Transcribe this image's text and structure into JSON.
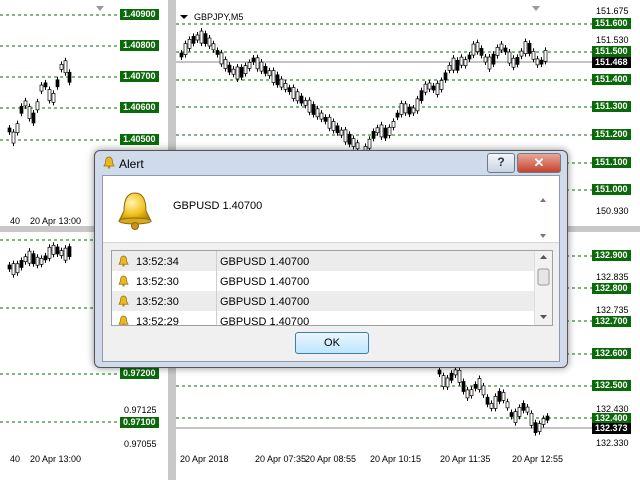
{
  "charts": {
    "tl": {
      "levels": [
        "1.40900",
        "1.40800",
        "1.40700",
        "1.40600",
        "1.40500"
      ],
      "x_labels": [
        "40",
        "20 Apr 13:00"
      ]
    },
    "bl": {
      "levels": [
        "0.97200",
        "0.97100"
      ],
      "prices": [
        "0.97125",
        "0.97055"
      ],
      "x_labels": [
        "40",
        "20 Apr 13:00"
      ]
    },
    "tr": {
      "title": "GBPJPY,M5",
      "levels": [
        "151.600",
        "151.500",
        "151.400",
        "151.300",
        "151.200",
        "151.100",
        "151.000"
      ],
      "current": "151.468",
      "prices": [
        "151.530",
        "150.930"
      ]
    },
    "br": {
      "levels": [
        "132.900",
        "132.800",
        "132.700",
        "132.600",
        "132.500",
        "132.400"
      ],
      "current": "132.373",
      "prices": [
        "132.835",
        "132.735",
        "132.430",
        "132.330"
      ],
      "x_labels": [
        "20 Apr 2018",
        "20 Apr 07:35",
        "20 Apr 08:55",
        "20 Apr 10:15",
        "20 Apr 11:35",
        "20 Apr 12:55"
      ]
    }
  },
  "alert": {
    "title": "Alert",
    "help_label": "?",
    "close_label": "✕",
    "message": "GBPUSD 1.40700",
    "rows": [
      {
        "time": "13:52:34",
        "text": "GBPUSD 1.40700"
      },
      {
        "time": "13:52:30",
        "text": "GBPUSD 1.40700"
      },
      {
        "time": "13:52:30",
        "text": "GBPUSD 1.40700"
      },
      {
        "time": "13:52:29",
        "text": "GBPUSD 1.40700"
      }
    ],
    "ok_label": "OK"
  },
  "colors": {
    "level_bg": "#0a6a0a",
    "candle": "#000000",
    "grid": "#0a6a0a"
  }
}
